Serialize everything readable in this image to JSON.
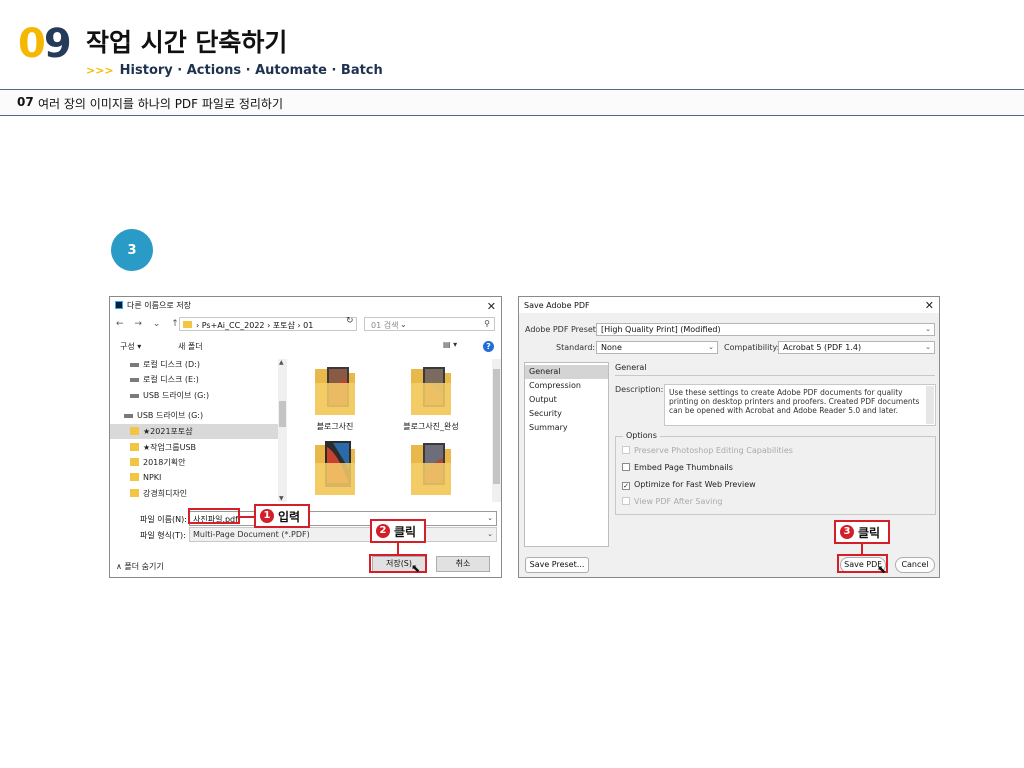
{
  "header": {
    "chapter_digit1": "0",
    "chapter_digit2": "9",
    "chapter_title": "작업 시간 단축하기",
    "subtitle_arrows": ">>>",
    "subtitle": "History · Actions · Automate · Batch",
    "section_number": "07",
    "section_title": "여러 장의 이미지를 하나의 PDF 파일로 정리하기"
  },
  "step": {
    "number": "3"
  },
  "save_as_dialog": {
    "title": "다른 이름으로 저장",
    "nav_icons": "← → ⌄ ↑",
    "breadcrumb": "› Ps+Ai_CC_2022 › 포토샵 › 01",
    "search_placeholder": "01 검색",
    "toolbar": {
      "organize": "구성 ▾",
      "new_folder": "새 폴더"
    },
    "tree": [
      {
        "label": "로컬 디스크 (D:)",
        "type": "drive"
      },
      {
        "label": "로컬 디스크 (E:)",
        "type": "drive"
      },
      {
        "label": "USB 드라이브 (G:)",
        "type": "drive"
      },
      {
        "label": "USB 드라이브 (G:)",
        "type": "drive"
      },
      {
        "label": "★2021포토샵",
        "type": "folder",
        "selected": true
      },
      {
        "label": "★작업그룹USB",
        "type": "folder"
      },
      {
        "label": "2018기획안",
        "type": "folder"
      },
      {
        "label": "NPKI",
        "type": "folder"
      },
      {
        "label": "강경희디자인",
        "type": "folder"
      }
    ],
    "files": [
      {
        "name": "블로그사진"
      },
      {
        "name": "블로그사진_완성"
      },
      {
        "name": ""
      },
      {
        "name": ""
      }
    ],
    "file_name_label": "파일 이름(N):",
    "file_name_value": "사진파일.pdf",
    "file_type_label": "파일 형식(T):",
    "file_type_value": "Multi-Page Document (*.PDF)",
    "hide_folders": "∧ 폴더 숨기기",
    "save_button": "저장(S)",
    "cancel_button": "취소"
  },
  "pdf_dialog": {
    "title": "Save Adobe PDF",
    "preset_label": "Adobe PDF Preset:",
    "preset_value": "[High Quality Print] (Modified)",
    "standard_label": "Standard:",
    "standard_value": "None",
    "compat_label": "Compatibility:",
    "compat_value": "Acrobat 5 (PDF 1.4)",
    "sidebar": [
      "General",
      "Compression",
      "Output",
      "Security",
      "Summary"
    ],
    "panel_title": "General",
    "description_label": "Description:",
    "description_text": "Use these settings to create Adobe PDF documents for quality printing on desktop printers and proofers.  Created PDF documents can be opened with Acrobat and Adobe Reader 5.0 and later.",
    "options_title": "Options",
    "options": [
      {
        "label": "Preserve Photoshop Editing Capabilities",
        "checked": false,
        "disabled": true
      },
      {
        "label": "Embed Page Thumbnails",
        "checked": false,
        "disabled": false
      },
      {
        "label": "Optimize for Fast Web Preview",
        "checked": true,
        "disabled": false
      },
      {
        "label": "View PDF After Saving",
        "checked": false,
        "disabled": true
      }
    ],
    "save_preset_button": "Save Preset...",
    "save_pdf_button": "Save PDF",
    "cancel_button": "Cancel"
  },
  "callouts": [
    {
      "num": "1",
      "text": "입력"
    },
    {
      "num": "2",
      "text": "클릭"
    },
    {
      "num": "3",
      "text": "클릭"
    }
  ],
  "colors": {
    "accent_yellow": "#f5b800",
    "navy": "#243b5a",
    "step_blue": "#2a9bc7",
    "callout_red": "#d21f2a"
  }
}
